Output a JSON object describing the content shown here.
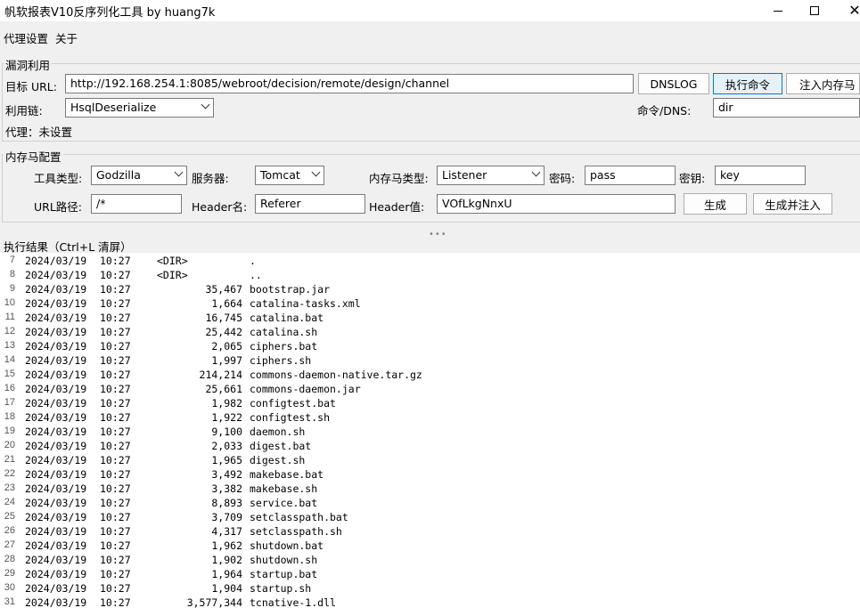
{
  "window": {
    "title": "帆软报表V10反序列化工具 by huang7k",
    "min_icon": "minimize-icon",
    "max_icon": "maximize-icon",
    "close_icon": "close-icon"
  },
  "menu": [
    "代理设置",
    "关于"
  ],
  "exploit": {
    "group_label": "漏洞利用",
    "url_label": "目标 URL:",
    "url_value": "http://192.168.254.1:8085/webroot/decision/remote/design/channel",
    "dnslog_button": "DNSLOG",
    "exec_button": "执行命令",
    "inject_button": "注入内存马",
    "chain_label": "利用链:",
    "chain_value": "HsqlDeserialize",
    "cmd_label": "命令/DNS:",
    "cmd_value": "dir",
    "proxy_label": "代理：未设置"
  },
  "memshell": {
    "group_label": "内存马配置",
    "tool_label": "工具类型:",
    "tool_value": "Godzilla",
    "server_label": "服务器:",
    "server_value": "Tomcat",
    "shell_type_label": "内存马类型:",
    "shell_type_value": "Listener",
    "password_label": "密码:",
    "password_value": "pass",
    "key_label": "密钥:",
    "key_value": "key",
    "url_path_label": "URL路径:",
    "url_path_value": "/*",
    "header_name_label": "Header名:",
    "header_name_value": "Referer",
    "header_value_label": "Header值:",
    "header_value_value": "VOfLkgNnxU",
    "generate_button": "生成",
    "generate_inject_button": "生成并注入"
  },
  "result": {
    "label": "执行结果（Ctrl+L 清屏）",
    "lines": [
      {
        "n": "7",
        "date": "2024/03/19",
        "time": "10:27",
        "size": "<DIR>",
        "name": "."
      },
      {
        "n": "8",
        "date": "2024/03/19",
        "time": "10:27",
        "size": "<DIR>",
        "name": ".."
      },
      {
        "n": "9",
        "date": "2024/03/19",
        "time": "10:27",
        "size": "35,467",
        "name": "bootstrap.jar"
      },
      {
        "n": "10",
        "date": "2024/03/19",
        "time": "10:27",
        "size": "1,664",
        "name": "catalina-tasks.xml"
      },
      {
        "n": "11",
        "date": "2024/03/19",
        "time": "10:27",
        "size": "16,745",
        "name": "catalina.bat"
      },
      {
        "n": "12",
        "date": "2024/03/19",
        "time": "10:27",
        "size": "25,442",
        "name": "catalina.sh"
      },
      {
        "n": "13",
        "date": "2024/03/19",
        "time": "10:27",
        "size": "2,065",
        "name": "ciphers.bat"
      },
      {
        "n": "14",
        "date": "2024/03/19",
        "time": "10:27",
        "size": "1,997",
        "name": "ciphers.sh"
      },
      {
        "n": "15",
        "date": "2024/03/19",
        "time": "10:27",
        "size": "214,214",
        "name": "commons-daemon-native.tar.gz"
      },
      {
        "n": "16",
        "date": "2024/03/19",
        "time": "10:27",
        "size": "25,661",
        "name": "commons-daemon.jar"
      },
      {
        "n": "17",
        "date": "2024/03/19",
        "time": "10:27",
        "size": "1,982",
        "name": "configtest.bat"
      },
      {
        "n": "18",
        "date": "2024/03/19",
        "time": "10:27",
        "size": "1,922",
        "name": "configtest.sh"
      },
      {
        "n": "19",
        "date": "2024/03/19",
        "time": "10:27",
        "size": "9,100",
        "name": "daemon.sh"
      },
      {
        "n": "20",
        "date": "2024/03/19",
        "time": "10:27",
        "size": "2,033",
        "name": "digest.bat"
      },
      {
        "n": "21",
        "date": "2024/03/19",
        "time": "10:27",
        "size": "1,965",
        "name": "digest.sh"
      },
      {
        "n": "22",
        "date": "2024/03/19",
        "time": "10:27",
        "size": "3,492",
        "name": "makebase.bat"
      },
      {
        "n": "23",
        "date": "2024/03/19",
        "time": "10:27",
        "size": "3,382",
        "name": "makebase.sh"
      },
      {
        "n": "24",
        "date": "2024/03/19",
        "time": "10:27",
        "size": "8,893",
        "name": "service.bat"
      },
      {
        "n": "25",
        "date": "2024/03/19",
        "time": "10:27",
        "size": "3,709",
        "name": "setclasspath.bat"
      },
      {
        "n": "26",
        "date": "2024/03/19",
        "time": "10:27",
        "size": "4,317",
        "name": "setclasspath.sh"
      },
      {
        "n": "27",
        "date": "2024/03/19",
        "time": "10:27",
        "size": "1,962",
        "name": "shutdown.bat"
      },
      {
        "n": "28",
        "date": "2024/03/19",
        "time": "10:27",
        "size": "1,902",
        "name": "shutdown.sh"
      },
      {
        "n": "29",
        "date": "2024/03/19",
        "time": "10:27",
        "size": "1,964",
        "name": "startup.bat"
      },
      {
        "n": "30",
        "date": "2024/03/19",
        "time": "10:27",
        "size": "1,904",
        "name": "startup.sh"
      },
      {
        "n": "31",
        "date": "2024/03/19",
        "time": "10:27",
        "size": "3,577,344",
        "name": "tcnative-1.dll"
      }
    ]
  }
}
